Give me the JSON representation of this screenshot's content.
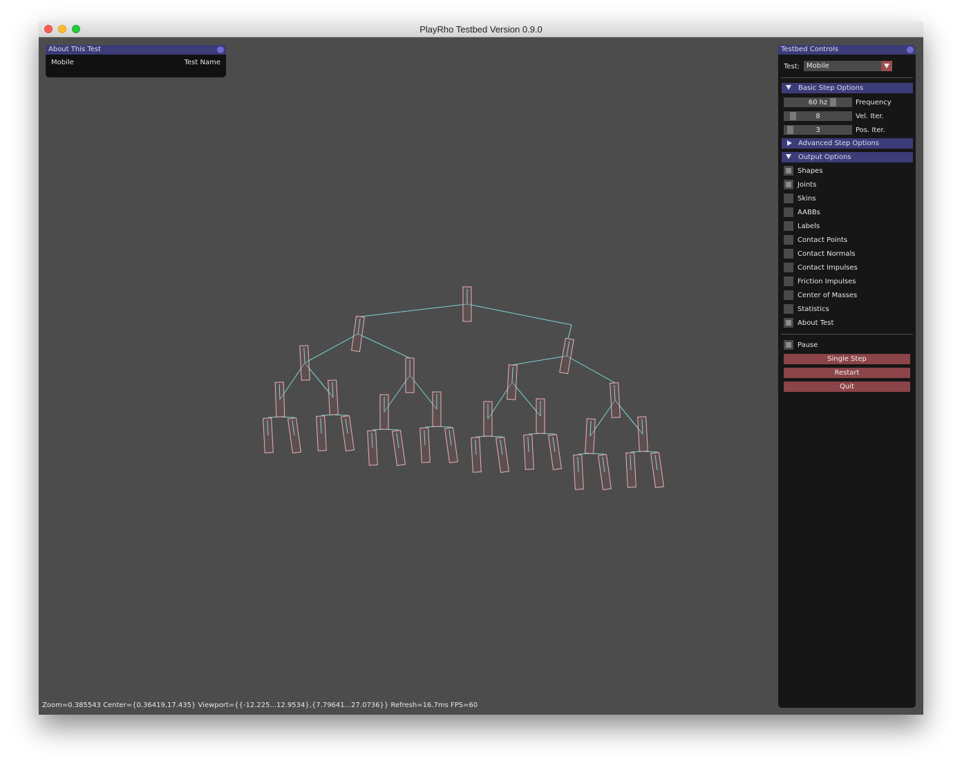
{
  "window": {
    "title": "PlayRho Testbed Version 0.9.0"
  },
  "about_panel": {
    "title": "About This Test",
    "test_value": "Mobile",
    "test_label": "Test Name"
  },
  "controls": {
    "title": "Testbed Controls",
    "test_label": "Test:",
    "test_selected": "Mobile",
    "basic_header": "Basic Step Options",
    "frequency": {
      "value": "60 hz",
      "label": "Frequency"
    },
    "vel_iter": {
      "value": "8",
      "label": "Vel. Iter."
    },
    "pos_iter": {
      "value": "3",
      "label": "Pos. Iter."
    },
    "advanced_header": "Advanced Step Options",
    "output_header": "Output Options",
    "outputs": [
      {
        "label": "Shapes",
        "checked": true
      },
      {
        "label": "Joints",
        "checked": true
      },
      {
        "label": "Skins",
        "checked": false
      },
      {
        "label": "AABBs",
        "checked": false
      },
      {
        "label": "Labels",
        "checked": false
      },
      {
        "label": "Contact Points",
        "checked": false
      },
      {
        "label": "Contact Normals",
        "checked": false
      },
      {
        "label": "Contact Impulses",
        "checked": false
      },
      {
        "label": "Friction Impulses",
        "checked": false
      },
      {
        "label": "Center of Masses",
        "checked": false
      },
      {
        "label": "Statistics",
        "checked": false
      },
      {
        "label": "About Test",
        "checked": true
      }
    ],
    "pause": {
      "label": "Pause",
      "checked": true
    },
    "single_step_label": "Single Step",
    "restart_label": "Restart",
    "quit_label": "Quit"
  },
  "status_line": "Zoom=0.385543 Center={0.36419,17.435} Viewport={{-12.225...12.9534},{7.79641...27.0736}} Refresh=16.7ms FPS=60",
  "colors": {
    "body_outline": "#e8b4b8",
    "body_fill": "#7a5558",
    "joint_line": "#7fd6d6",
    "button": "#8b4448",
    "header": "#3c3c78"
  }
}
